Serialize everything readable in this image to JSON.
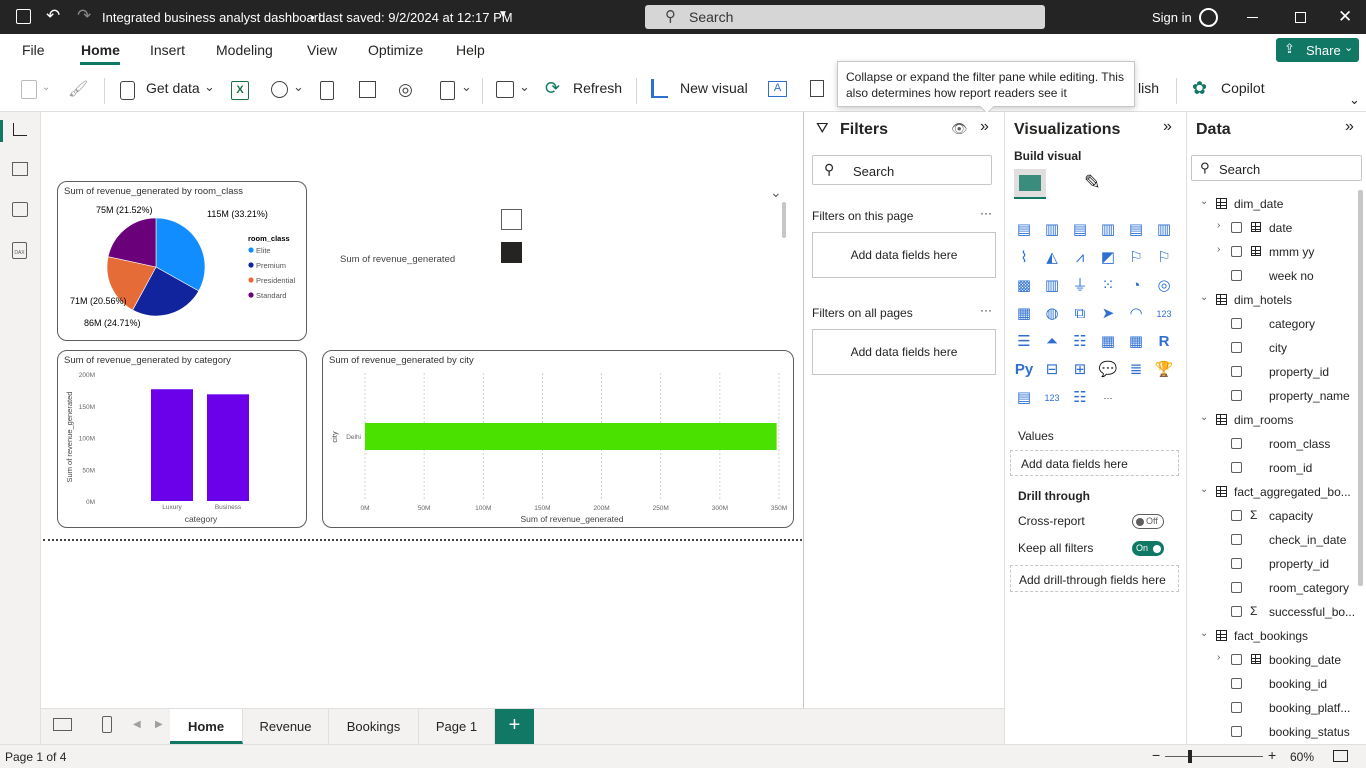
{
  "titlebar": {
    "title": "Integrated business analyst dashboard",
    "saved": "• Last saved: 9/2/2024 at 12:17 PM",
    "search_placeholder": "Search",
    "signin": "Sign in"
  },
  "menu": {
    "items": [
      "File",
      "Home",
      "Insert",
      "Modeling",
      "View",
      "Optimize",
      "Help"
    ],
    "active": "Home",
    "share": "Share"
  },
  "ribbon": {
    "get_data": "Get data",
    "refresh": "Refresh",
    "new_visual": "New visual",
    "publish_partial": "lish",
    "copilot": "Copilot"
  },
  "tooltip": "Collapse or expand the filter pane while editing. This also determines how report readers see it",
  "pie_card": {
    "title": "Sum of revenue_generated by room_class",
    "legend_title": "room_class",
    "legend": [
      {
        "label": "Elite",
        "color": "#118dff"
      },
      {
        "label": "Premium",
        "color": "#12239e"
      },
      {
        "label": "Presidential",
        "color": "#e66c37"
      },
      {
        "label": "Standard",
        "color": "#6b007b"
      }
    ],
    "labels": {
      "elite": "115M (33.21%)",
      "premium": "86M (24.71%)",
      "presidential": "71M (20.56%)",
      "standard": "75M (21.52%)"
    }
  },
  "pie_chart_data": {
    "type": "pie",
    "slices": [
      {
        "label": "Elite",
        "value": 115,
        "pct": 33.21,
        "color": "#118dff"
      },
      {
        "label": "Premium",
        "value": 86,
        "pct": 24.71,
        "color": "#12239e"
      },
      {
        "label": "Presidential",
        "value": 71,
        "pct": 20.56,
        "color": "#e66c37"
      },
      {
        "label": "Standard",
        "value": 75,
        "pct": 21.52,
        "color": "#6b007b"
      }
    ]
  },
  "kpi_label": "Sum of revenue_generated",
  "chart_data": [
    {
      "type": "bar",
      "title": "Sum of revenue_generated by category",
      "categories": [
        "Luxury",
        "Business"
      ],
      "values": [
        176,
        168
      ],
      "xlabel": "category",
      "ylabel": "Sum of revenue_generated",
      "ylim": [
        0,
        200
      ],
      "yticks": [
        "0M",
        "50M",
        "100M",
        "150M",
        "200M"
      ],
      "color": "#6b00eb"
    },
    {
      "type": "bar",
      "orientation": "horizontal",
      "title": "Sum of revenue_generated by city",
      "categories": [
        "Delhi"
      ],
      "values": [
        348
      ],
      "xlabel": "Sum of revenue_generated",
      "ylabel": "city",
      "xlim": [
        0,
        350
      ],
      "xticks": [
        "0M",
        "50M",
        "100M",
        "150M",
        "200M",
        "250M",
        "300M",
        "350M"
      ],
      "color": "#4ae100"
    }
  ],
  "filters": {
    "title": "Filters",
    "search": "Search",
    "on_page": "Filters on this page",
    "on_all": "Filters on all pages",
    "add": "Add data fields here"
  },
  "viz": {
    "title": "Visualizations",
    "build": "Build visual",
    "values": "Values",
    "add_values": "Add data fields here",
    "drill": "Drill through",
    "cross": "Cross-report",
    "cross_state": "Off",
    "keep": "Keep all filters",
    "keep_state": "On",
    "add_drill": "Add drill-through fields here"
  },
  "data": {
    "title": "Data",
    "search": "Search",
    "tree": [
      {
        "type": "table",
        "label": "dim_date"
      },
      {
        "type": "field",
        "label": "date",
        "expand": true,
        "hier": true
      },
      {
        "type": "field",
        "label": "mmm yy",
        "expand": true,
        "hier": true
      },
      {
        "type": "field",
        "label": "week no"
      },
      {
        "type": "table",
        "label": "dim_hotels"
      },
      {
        "type": "field",
        "label": "category"
      },
      {
        "type": "field",
        "label": "city"
      },
      {
        "type": "field",
        "label": "property_id"
      },
      {
        "type": "field",
        "label": "property_name"
      },
      {
        "type": "table",
        "label": "dim_rooms"
      },
      {
        "type": "field",
        "label": "room_class"
      },
      {
        "type": "field",
        "label": "room_id"
      },
      {
        "type": "table",
        "label": "fact_aggregated_bo..."
      },
      {
        "type": "field",
        "label": "capacity",
        "sigma": true
      },
      {
        "type": "field",
        "label": "check_in_date"
      },
      {
        "type": "field",
        "label": "property_id"
      },
      {
        "type": "field",
        "label": "room_category"
      },
      {
        "type": "field",
        "label": "successful_bo...",
        "sigma": true
      },
      {
        "type": "table",
        "label": "fact_bookings"
      },
      {
        "type": "field",
        "label": "booking_date",
        "expand": true,
        "hier": true
      },
      {
        "type": "field",
        "label": "booking_id"
      },
      {
        "type": "field",
        "label": "booking_platf..."
      },
      {
        "type": "field",
        "label": "booking_status"
      }
    ]
  },
  "tabs": [
    "Home",
    "Revenue",
    "Bookings",
    "Page 1"
  ],
  "status": {
    "page": "Page 1 of 4",
    "zoom": "60%"
  }
}
